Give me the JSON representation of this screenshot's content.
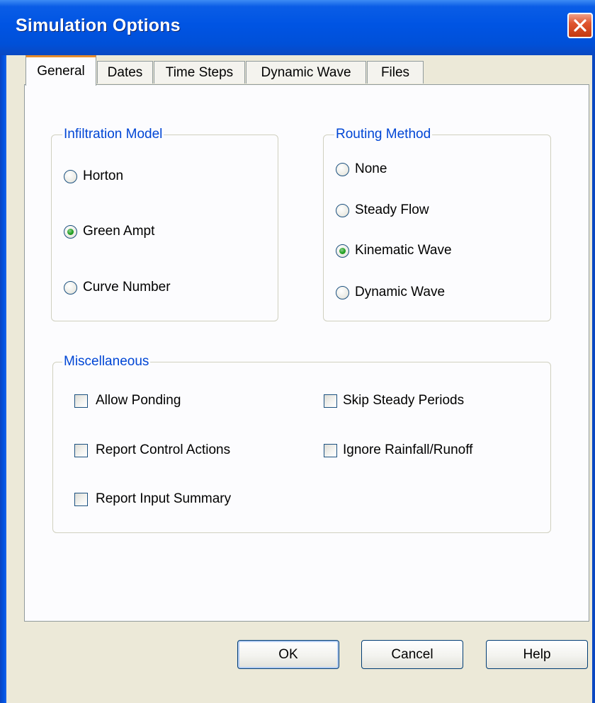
{
  "window": {
    "title": "Simulation Options"
  },
  "tabs": [
    {
      "label": "General",
      "active": true
    },
    {
      "label": "Dates",
      "active": false
    },
    {
      "label": "Time Steps",
      "active": false
    },
    {
      "label": "Dynamic Wave",
      "active": false
    },
    {
      "label": "Files",
      "active": false
    }
  ],
  "infiltration": {
    "legend": "Infiltration Model",
    "options": [
      {
        "label": "Horton",
        "checked": false
      },
      {
        "label": "Green Ampt",
        "checked": true
      },
      {
        "label": "Curve Number",
        "checked": false
      }
    ]
  },
  "routing": {
    "legend": "Routing Method",
    "options": [
      {
        "label": "None",
        "checked": false
      },
      {
        "label": "Steady Flow",
        "checked": false
      },
      {
        "label": "Kinematic Wave",
        "checked": true
      },
      {
        "label": "Dynamic Wave",
        "checked": false
      }
    ]
  },
  "misc": {
    "legend": "Miscellaneous",
    "options": [
      {
        "label": "Allow Ponding",
        "checked": false
      },
      {
        "label": "Report Control Actions",
        "checked": false
      },
      {
        "label": "Report Input Summary",
        "checked": false
      },
      {
        "label": "Skip Steady Periods",
        "checked": false
      },
      {
        "label": "Ignore Rainfall/Runoff",
        "checked": false
      }
    ]
  },
  "buttons": {
    "ok": "OK",
    "cancel": "Cancel",
    "help": "Help"
  },
  "colors": {
    "titlebar": "#0054e3",
    "legend_text": "#0046d5",
    "dialog_bg": "#ece9d8",
    "tab_accent": "#e68b2c"
  },
  "icons": {
    "close": "close-icon"
  }
}
